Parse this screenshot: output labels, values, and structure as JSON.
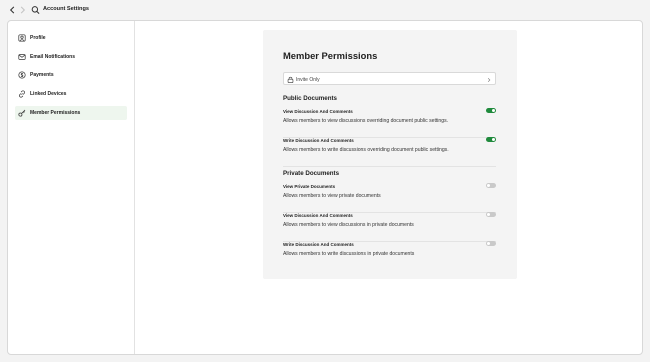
{
  "header": {
    "title": "Account Settings"
  },
  "icons": {
    "back": "chevron-left-icon",
    "forward": "chevron-right-icon",
    "search": "search-icon"
  },
  "sidebar": {
    "items": [
      {
        "label": "Profile",
        "icon": "user-square-icon",
        "active": false
      },
      {
        "label": "Email Notifications",
        "icon": "envelope-icon",
        "active": false
      },
      {
        "label": "Payments",
        "icon": "dollar-circle-icon",
        "active": false
      },
      {
        "label": "Linked Devices",
        "icon": "link-icon",
        "active": false
      },
      {
        "label": "Member Permissions",
        "icon": "key-icon",
        "active": true
      }
    ]
  },
  "main": {
    "title": "Member Permissions",
    "access_select": {
      "value": "Invite Only",
      "icon": "lock-icon"
    },
    "public_section": {
      "title": "Public Documents",
      "items": [
        {
          "title": "View Discussion And Comments",
          "description": "Allows members to view discussions overriding document public settings.",
          "enabled": true
        },
        {
          "title": "Write Discussion And Comments",
          "description": "Allows members to write discussions overriding document public settings.",
          "enabled": true
        }
      ]
    },
    "private_section": {
      "title": "Private Documents",
      "items": [
        {
          "title": "View Private Documents",
          "description": "Allows members to view private documents",
          "enabled": false
        },
        {
          "title": "View Discussion And Comments",
          "description": "Allows members to view discussions in private documents",
          "enabled": false
        },
        {
          "title": "Write Discussion And Comments",
          "description": "Allows members to write discussions in private documents",
          "enabled": false
        }
      ]
    }
  },
  "colors": {
    "accent": "#1f8a3c",
    "active_bg": "#eef6ee",
    "toggle_off": "#c9c9c9"
  }
}
